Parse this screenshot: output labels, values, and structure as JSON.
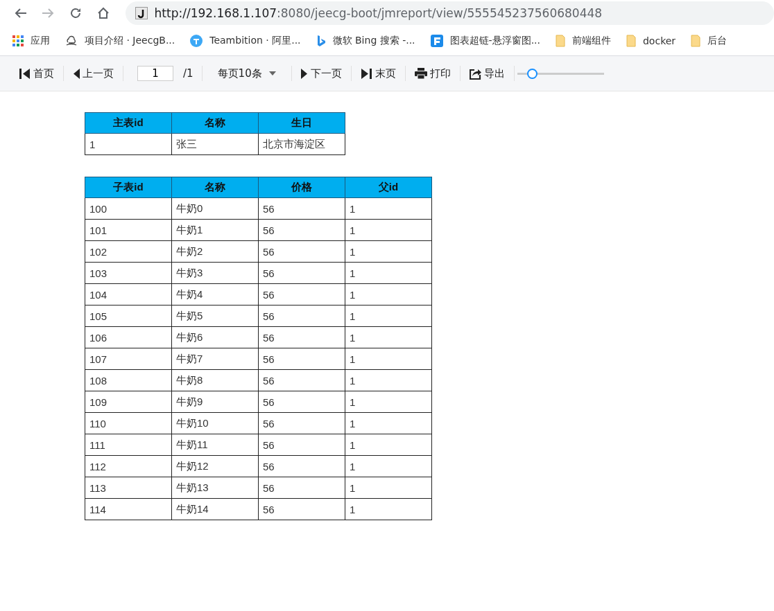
{
  "browser": {
    "url_host": "http://192.168.1.107",
    "url_path": ":8080/jeecg-boot/jmreport/view/555545237560680448",
    "bookmarks": [
      {
        "label": "应用",
        "kind": "apps"
      },
      {
        "label": "项目介绍 · JeecgB...",
        "kind": "cloud"
      },
      {
        "label": "Teambition · 阿里...",
        "kind": "teambition"
      },
      {
        "label": "微软 Bing 搜索 -...",
        "kind": "bing"
      },
      {
        "label": "图表超链-悬浮窗图...",
        "kind": "chart"
      },
      {
        "label": "前端组件",
        "kind": "folder"
      },
      {
        "label": "docker",
        "kind": "folder"
      },
      {
        "label": "后台",
        "kind": "folder"
      }
    ]
  },
  "toolbar": {
    "items": [
      {
        "kind": "first",
        "label": "首页"
      },
      {
        "kind": "prev",
        "label": "上一页"
      },
      {
        "kind": "page",
        "value": "1",
        "total": "/1"
      },
      {
        "kind": "pagesize",
        "label": "每页10条"
      },
      {
        "kind": "next",
        "label": "下一页"
      },
      {
        "kind": "last",
        "label": "末页"
      },
      {
        "kind": "print",
        "label": "打印"
      },
      {
        "kind": "export",
        "label": "导出"
      },
      {
        "kind": "zoom",
        "level": 0.13
      }
    ]
  },
  "main_table": {
    "columns": [
      "主表id",
      "名称",
      "生日"
    ],
    "rows": [
      [
        "1",
        "张三",
        "北京市海淀区"
      ]
    ]
  },
  "sub_table": {
    "columns": [
      "子表id",
      "名称",
      "价格",
      "父id"
    ],
    "rows": [
      [
        "100",
        "牛奶0",
        "56",
        "1"
      ],
      [
        "101",
        "牛奶1",
        "56",
        "1"
      ],
      [
        "102",
        "牛奶2",
        "56",
        "1"
      ],
      [
        "103",
        "牛奶3",
        "56",
        "1"
      ],
      [
        "104",
        "牛奶4",
        "56",
        "1"
      ],
      [
        "105",
        "牛奶5",
        "56",
        "1"
      ],
      [
        "106",
        "牛奶6",
        "56",
        "1"
      ],
      [
        "107",
        "牛奶7",
        "56",
        "1"
      ],
      [
        "108",
        "牛奶8",
        "56",
        "1"
      ],
      [
        "109",
        "牛奶9",
        "56",
        "1"
      ],
      [
        "110",
        "牛奶10",
        "56",
        "1"
      ],
      [
        "111",
        "牛奶11",
        "56",
        "1"
      ],
      [
        "112",
        "牛奶12",
        "56",
        "1"
      ],
      [
        "113",
        "牛奶13",
        "56",
        "1"
      ],
      [
        "114",
        "牛奶14",
        "56",
        "1"
      ]
    ]
  }
}
